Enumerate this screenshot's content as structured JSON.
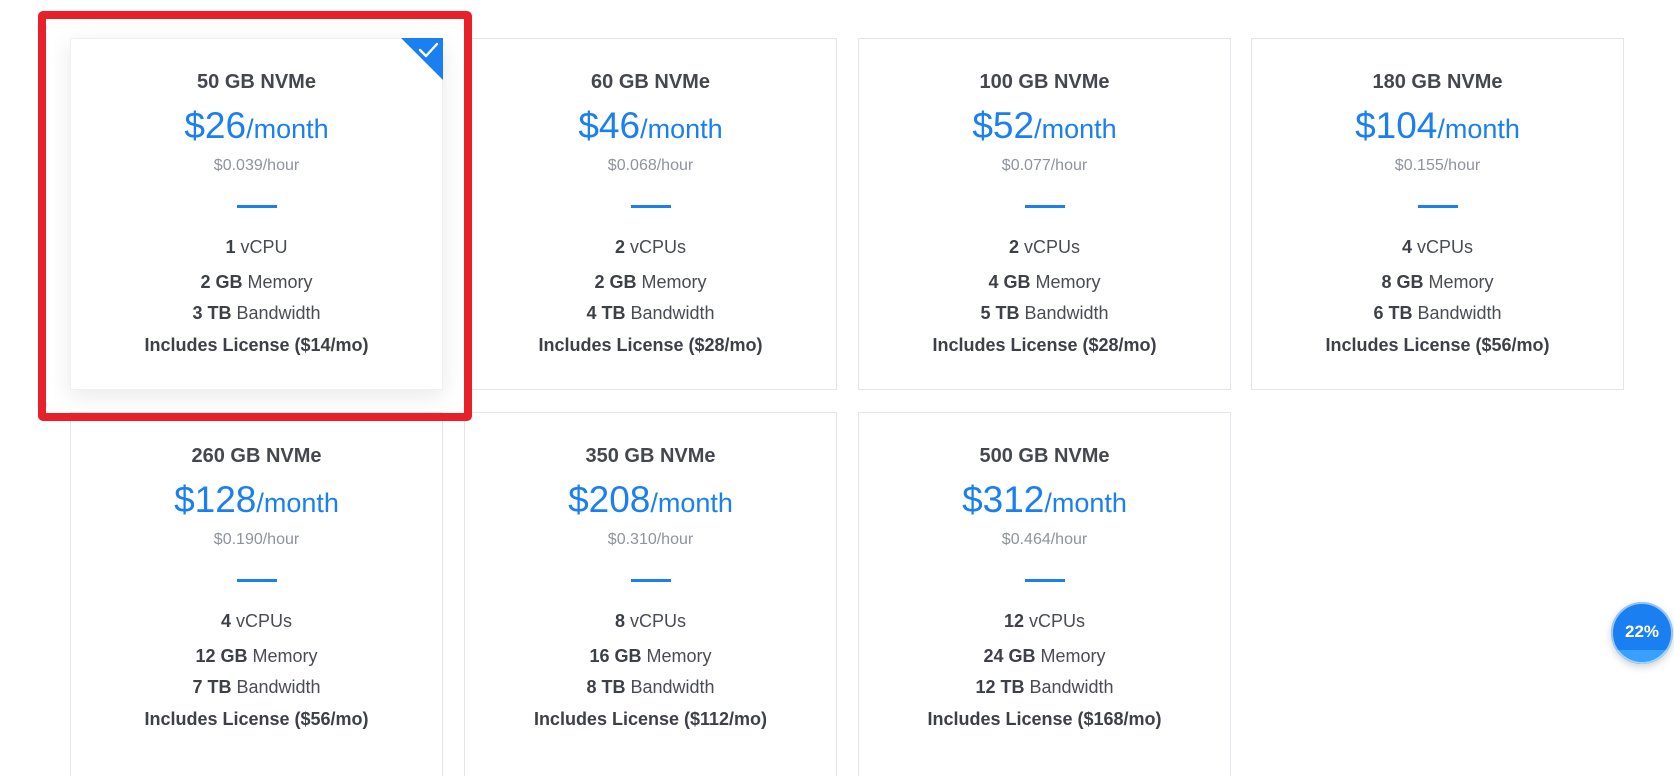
{
  "plans": [
    {
      "name": "50 GB NVMe",
      "price": "$26",
      "period": "/month",
      "hourly": "$0.039/hour",
      "cpu_count": "1",
      "cpu_label": "vCPU",
      "mem_amount": "2 GB",
      "mem_label": "Memory",
      "bw_amount": "3 TB",
      "bw_label": "Bandwidth",
      "license": "Includes License ($14/mo)",
      "selected": true
    },
    {
      "name": "60 GB NVMe",
      "price": "$46",
      "period": "/month",
      "hourly": "$0.068/hour",
      "cpu_count": "2",
      "cpu_label": "vCPUs",
      "mem_amount": "2 GB",
      "mem_label": "Memory",
      "bw_amount": "4 TB",
      "bw_label": "Bandwidth",
      "license": "Includes License ($28/mo)",
      "selected": false
    },
    {
      "name": "100 GB NVMe",
      "price": "$52",
      "period": "/month",
      "hourly": "$0.077/hour",
      "cpu_count": "2",
      "cpu_label": "vCPUs",
      "mem_amount": "4 GB",
      "mem_label": "Memory",
      "bw_amount": "5 TB",
      "bw_label": "Bandwidth",
      "license": "Includes License ($28/mo)",
      "selected": false
    },
    {
      "name": "180 GB NVMe",
      "price": "$104",
      "period": "/month",
      "hourly": "$0.155/hour",
      "cpu_count": "4",
      "cpu_label": "vCPUs",
      "mem_amount": "8 GB",
      "mem_label": "Memory",
      "bw_amount": "6 TB",
      "bw_label": "Bandwidth",
      "license": "Includes License ($56/mo)",
      "selected": false
    },
    {
      "name": "260 GB NVMe",
      "price": "$128",
      "period": "/month",
      "hourly": "$0.190/hour",
      "cpu_count": "4",
      "cpu_label": "vCPUs",
      "mem_amount": "12 GB",
      "mem_label": "Memory",
      "bw_amount": "7 TB",
      "bw_label": "Bandwidth",
      "license": "Includes License ($56/mo)",
      "selected": false
    },
    {
      "name": "350 GB NVMe",
      "price": "$208",
      "period": "/month",
      "hourly": "$0.310/hour",
      "cpu_count": "8",
      "cpu_label": "vCPUs",
      "mem_amount": "16 GB",
      "mem_label": "Memory",
      "bw_amount": "8 TB",
      "bw_label": "Bandwidth",
      "license": "Includes License ($112/mo)",
      "selected": false
    },
    {
      "name": "500 GB NVMe",
      "price": "$312",
      "period": "/month",
      "hourly": "$0.464/hour",
      "cpu_count": "12",
      "cpu_label": "vCPUs",
      "mem_amount": "24 GB",
      "mem_label": "Memory",
      "bw_amount": "12 TB",
      "bw_label": "Bandwidth",
      "license": "Includes License ($168/mo)",
      "selected": false
    }
  ],
  "selection_icon": "check-icon",
  "progress_badge": {
    "label": "22%",
    "value": 0.22
  },
  "colors": {
    "accent": "#1a7ff0",
    "highlight": "#e8202a",
    "card_border": "#e3e5ea",
    "muted_text": "#8f939c"
  }
}
